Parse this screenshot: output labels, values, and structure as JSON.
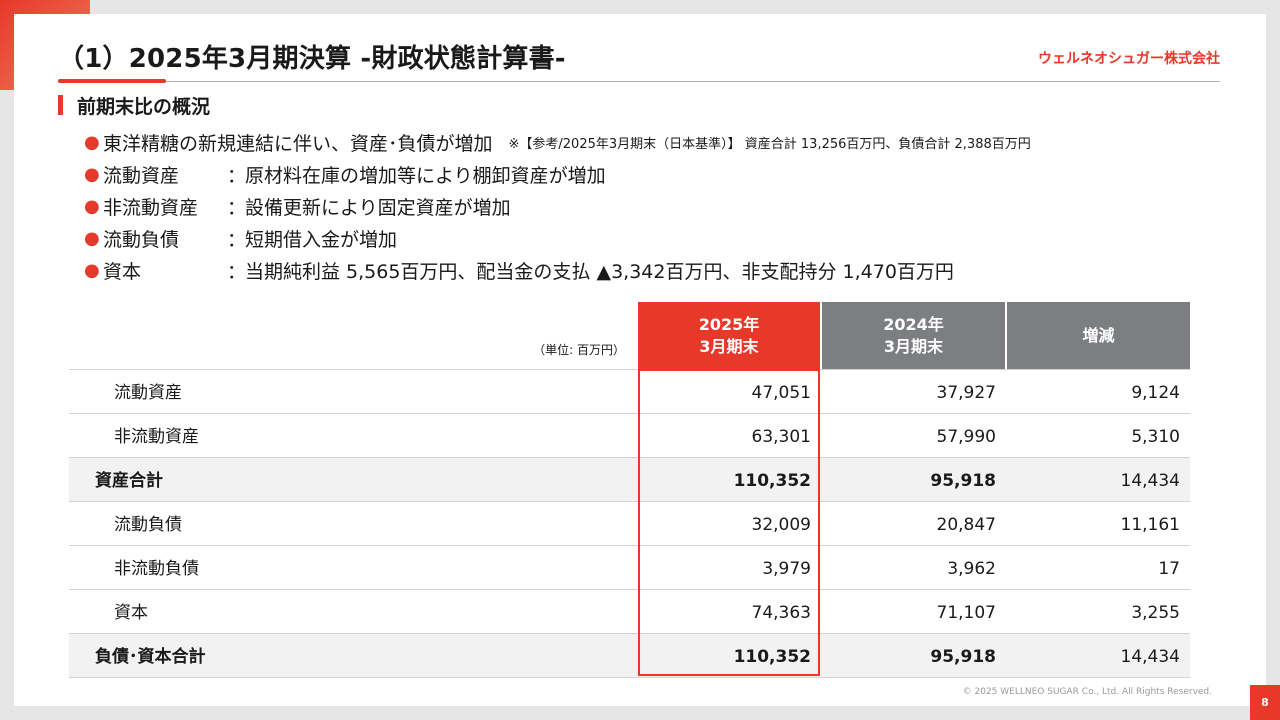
{
  "header": {
    "title": "（1）2025年3月期決算 -財政状態計算書-",
    "company": "ウェルネオシュガー株式会社"
  },
  "section": {
    "title": "前期末比の概況"
  },
  "bullets": [
    {
      "label": "東洋精糖の新規連結に伴い、資産･負債が増加",
      "colon": "",
      "text": "",
      "note": "※【参考/2025年3月期末（日本基準）】 資産合計 13,256百万円、負債合計 2,388百万円"
    },
    {
      "label": "流動資産",
      "colon": "：",
      "text": "原材料在庫の増加等により棚卸資産が増加",
      "note": ""
    },
    {
      "label": "非流動資産",
      "colon": "：",
      "text": "設備更新により固定資産が増加",
      "note": ""
    },
    {
      "label": "流動負債",
      "colon": "：",
      "text": "短期借入金が増加",
      "note": ""
    },
    {
      "label": "資本",
      "colon": "：",
      "text": "当期純利益 5,565百万円、配当金の支払 ▲3,342百万円、非支配持分 1,470百万円",
      "note": ""
    }
  ],
  "table": {
    "unit": "（単位: 百万円）",
    "columns": [
      {
        "line1": "2025年",
        "line2": "3月期末"
      },
      {
        "line1": "2024年",
        "line2": "3月期末"
      },
      {
        "line1": "増減",
        "line2": ""
      }
    ],
    "rows": [
      {
        "label": "流動資産",
        "cur": "47,051",
        "prev": "37,927",
        "diff": "9,124"
      },
      {
        "label": "非流動資産",
        "cur": "63,301",
        "prev": "57,990",
        "diff": "5,310"
      },
      {
        "label": "資産合計",
        "cur": "110,352",
        "prev": "95,918",
        "diff": "14,434"
      },
      {
        "label": "流動負債",
        "cur": "32,009",
        "prev": "20,847",
        "diff": "11,161"
      },
      {
        "label": "非流動負債",
        "cur": "3,979",
        "prev": "3,962",
        "diff": "17"
      },
      {
        "label": "資本",
        "cur": "74,363",
        "prev": "71,107",
        "diff": "3,255"
      },
      {
        "label": "負債･資本合計",
        "cur": "110,352",
        "prev": "95,918",
        "diff": "14,434"
      }
    ]
  },
  "footer": {
    "copyright": "© 2025 WELLNEO SUGAR Co., Ltd. All Rights Reserved.",
    "page": "8"
  },
  "colors": {
    "accent": "#e8382a",
    "header_gray": "#7d7e82"
  }
}
